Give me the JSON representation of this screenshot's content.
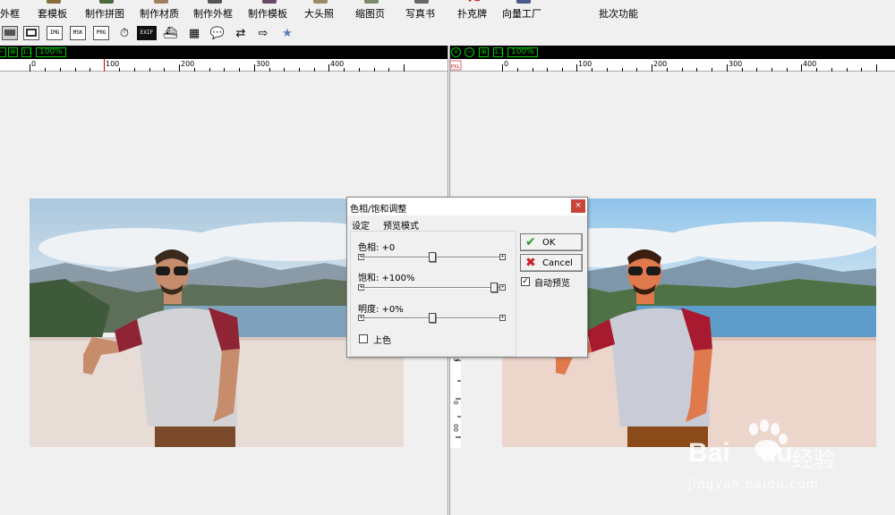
{
  "menu": {
    "items": [
      {
        "label": "外框"
      },
      {
        "label": "套模板"
      },
      {
        "label": "制作拼图"
      },
      {
        "label": "制作材质"
      },
      {
        "label": "制作外框"
      },
      {
        "label": "制作模板"
      },
      {
        "label": "大头照"
      },
      {
        "label": "缩图页"
      },
      {
        "label": "写真书"
      },
      {
        "label": "扑克牌"
      },
      {
        "label": "向量工厂"
      },
      {
        "label": "批次功能"
      }
    ]
  },
  "toolbar2": {
    "buttons": [
      {
        "icon": "landscape-icon",
        "text": ""
      },
      {
        "icon": "frame-icon",
        "text": ""
      },
      {
        "icon": "img-icon",
        "text": "IMG"
      },
      {
        "icon": "msk-icon",
        "text": "MSK"
      },
      {
        "icon": "prg-icon",
        "text": "PRG"
      },
      {
        "icon": "clock-icon",
        "text": "⏱"
      },
      {
        "icon": "exif-icon",
        "text": "EXIF"
      },
      {
        "icon": "ship-icon",
        "text": "⛴"
      },
      {
        "icon": "calendar-icon",
        "text": "▦"
      },
      {
        "icon": "speech-icon",
        "text": "💬"
      },
      {
        "icon": "arrows-icon",
        "text": "⇄"
      },
      {
        "icon": "arrow-right-icon",
        "text": "⇨"
      },
      {
        "icon": "star-icon",
        "text": "★"
      }
    ]
  },
  "left_pane": {
    "zoom": "100%",
    "ruler_labels": [
      "0",
      "100",
      "200",
      "300",
      "400"
    ]
  },
  "right_pane": {
    "zoom": "100%",
    "ruler_unit": "PXL",
    "ruler_labels": [
      "0",
      "100",
      "200",
      "300",
      "400"
    ]
  },
  "dialog": {
    "title": "色相/饱和调整",
    "close_label": "×",
    "menu": [
      "设定",
      "预览模式"
    ],
    "sliders": [
      {
        "label": "色相: +0",
        "value": 0,
        "min": -180,
        "max": 180
      },
      {
        "label": "饱和: +100%",
        "value": 100,
        "min": -100,
        "max": 100
      },
      {
        "label": "明度: +0%",
        "value": 0,
        "min": -100,
        "max": 100
      }
    ],
    "colorize": {
      "label": "上色",
      "checked": false
    },
    "ok_label": "OK",
    "cancel_label": "Cancel",
    "auto_preview": {
      "label": "自动预览",
      "checked": true
    }
  },
  "side_ruler": {
    "labels": [
      "0",
      "0",
      "00"
    ]
  },
  "watermark": {
    "brand": "Bai",
    "brand2": "du",
    "suffix": "经验",
    "url": "jingyan.baidu.com"
  },
  "colors": {
    "accent_red": "#c8433a",
    "zoom_green": "#00cc00",
    "ruler_marker": "#cc0000"
  }
}
